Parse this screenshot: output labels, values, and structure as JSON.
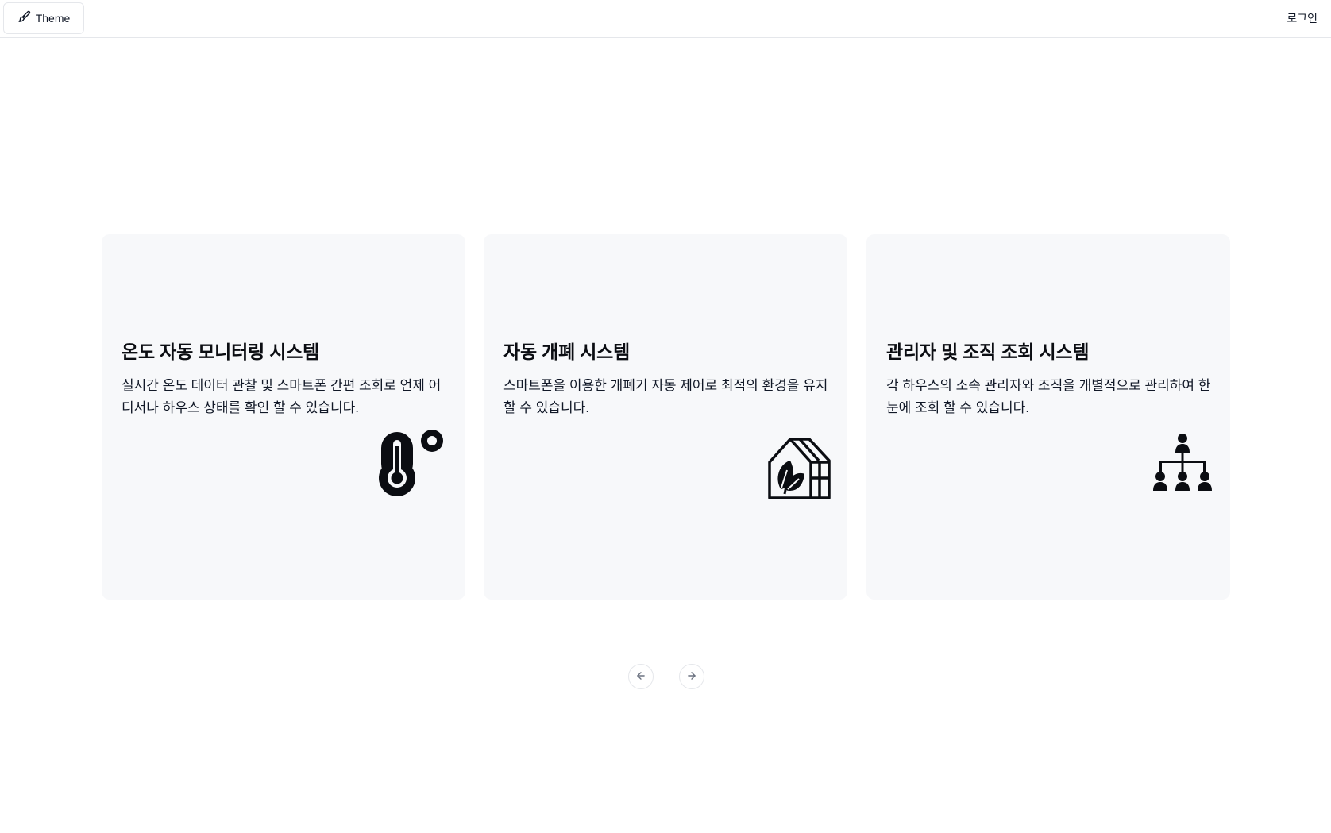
{
  "header": {
    "theme_label": "Theme",
    "theme_icon": "paint-brush-icon",
    "login_label": "로그인"
  },
  "cards": [
    {
      "title": "온도 자동 모니터링 시스템",
      "description": "실시간 온도 데이터 관찰 및 스마트폰 간편 조회로 언제 어디서나 하우스 상태를 확인 할 수 있습니다.",
      "icon": "thermometer-icon"
    },
    {
      "title": "자동 개폐 시스템",
      "description": "스마트폰을 이용한 개폐기 자동 제어로 최적의 환경을 유지 할 수 있습니다.",
      "icon": "greenhouse-icon"
    },
    {
      "title": "관리자 및 조직 조회 시스템",
      "description": "각 하우스의 소속 관리자와 조직을 개별적으로 관리하여 한 눈에 조회 할 수 있습니다.",
      "icon": "org-chart-icon"
    }
  ],
  "carousel_nav": {
    "prev_icon": "arrow-left-icon",
    "next_icon": "arrow-right-icon"
  },
  "colors": {
    "card_background": "#f7f8fa",
    "text": "#0b0d12",
    "border": "#e5e7eb"
  }
}
